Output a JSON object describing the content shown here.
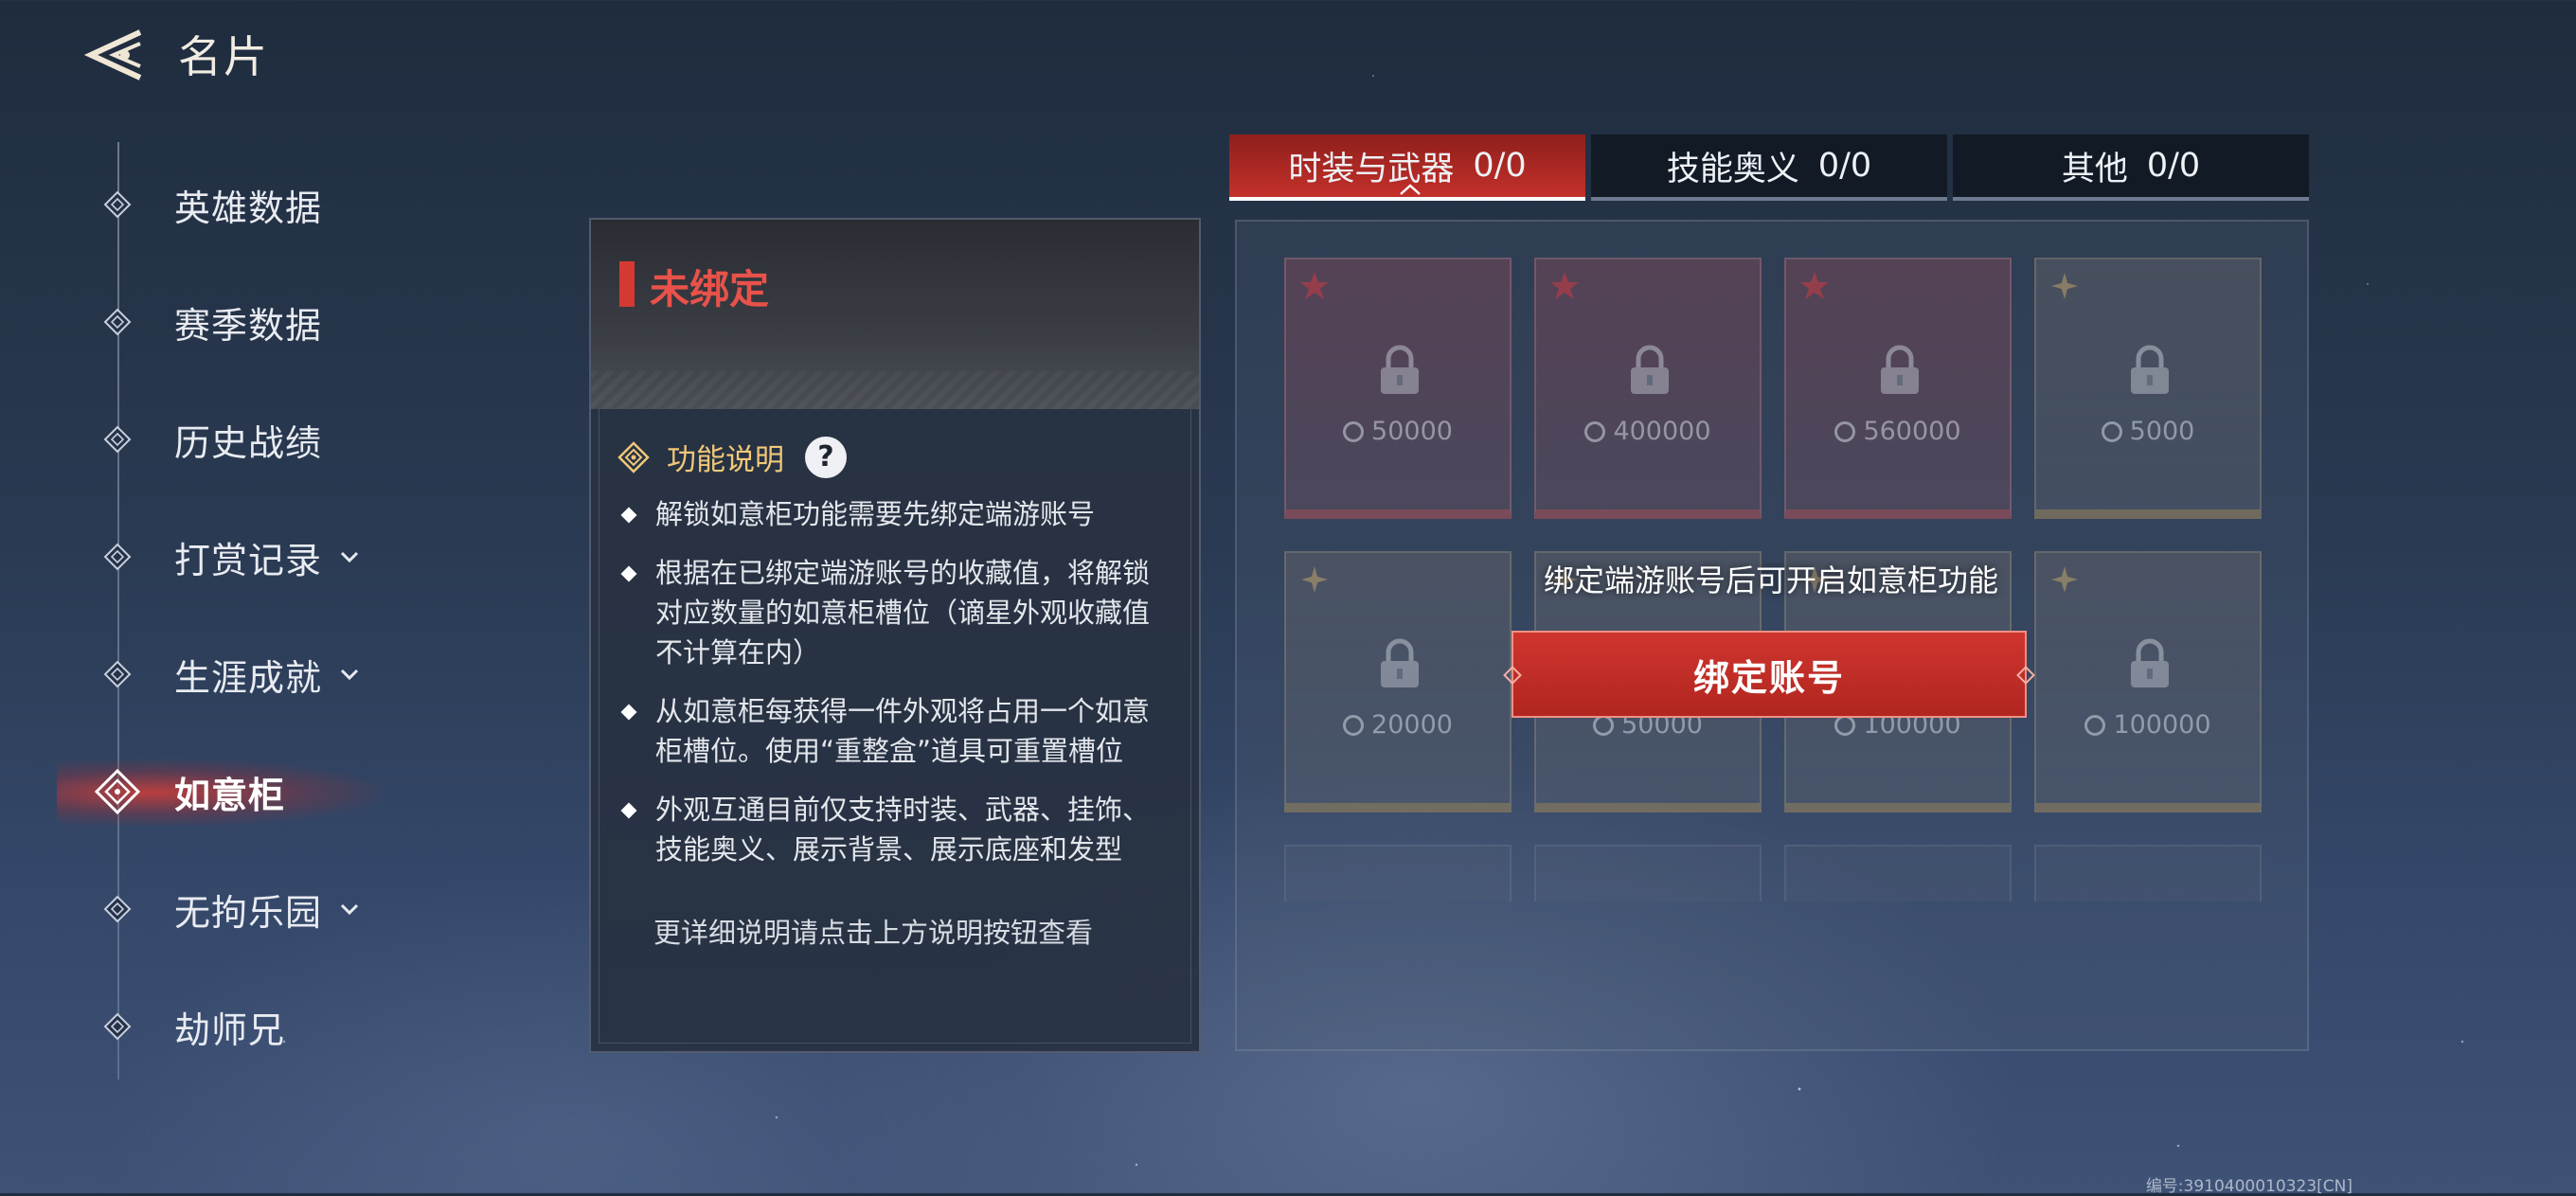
{
  "header": {
    "title": "名片",
    "back_icon": "back-arrow-icon"
  },
  "nav": {
    "items": [
      {
        "label": "英雄数据",
        "expandable": false,
        "active": false
      },
      {
        "label": "赛季数据",
        "expandable": false,
        "active": false
      },
      {
        "label": "历史战绩",
        "expandable": false,
        "active": false
      },
      {
        "label": "打赏记录",
        "expandable": true,
        "active": false
      },
      {
        "label": "生涯成就",
        "expandable": true,
        "active": false
      },
      {
        "label": "如意柜",
        "expandable": false,
        "active": true
      },
      {
        "label": "无拘乐园",
        "expandable": true,
        "active": false
      },
      {
        "label": "劫师兄",
        "expandable": false,
        "active": false
      }
    ]
  },
  "info": {
    "status": "未绑定",
    "section_title": "功能说明",
    "help_label": "?",
    "bullets": [
      "解锁如意柜功能需要先绑定端游账号",
      "根据在已绑定端游账号的收藏值，将解锁对应数量的如意柜槽位（谪星外观收藏值不计算在内）",
      "从如意柜每获得一件外观将占用一个如意柜槽位。使用“重整盒”道具可重置槽位",
      "外观互通目前仅支持时装、武器、挂饰、技能奥义、展示背景、展示底座和发型"
    ],
    "more_note": "更详细说明请点击上方说明按钮查看"
  },
  "tabs": [
    {
      "label": "时装与武器",
      "count": "0/0",
      "active": true
    },
    {
      "label": "技能奥义",
      "count": "0/0",
      "active": false
    },
    {
      "label": "其他",
      "count": "0/0",
      "active": false
    }
  ],
  "slots": [
    {
      "cost": "50000",
      "tier": "red"
    },
    {
      "cost": "400000",
      "tier": "red"
    },
    {
      "cost": "560000",
      "tier": "red"
    },
    {
      "cost": "5000",
      "tier": "gold"
    },
    {
      "cost": "20000",
      "tier": "gold"
    },
    {
      "cost": "50000",
      "tier": "gold"
    },
    {
      "cost": "100000",
      "tier": "gold"
    },
    {
      "cost": "100000",
      "tier": "gold"
    }
  ],
  "bind": {
    "hint": "绑定端游账号后可开启如意柜功能",
    "button_label": "绑定账号"
  },
  "footer": {
    "serial": "编号:3910400010323[CN]"
  },
  "colors": {
    "accent_red": "#c4302a",
    "status_red": "#e8524a",
    "gold": "#f0c878"
  }
}
